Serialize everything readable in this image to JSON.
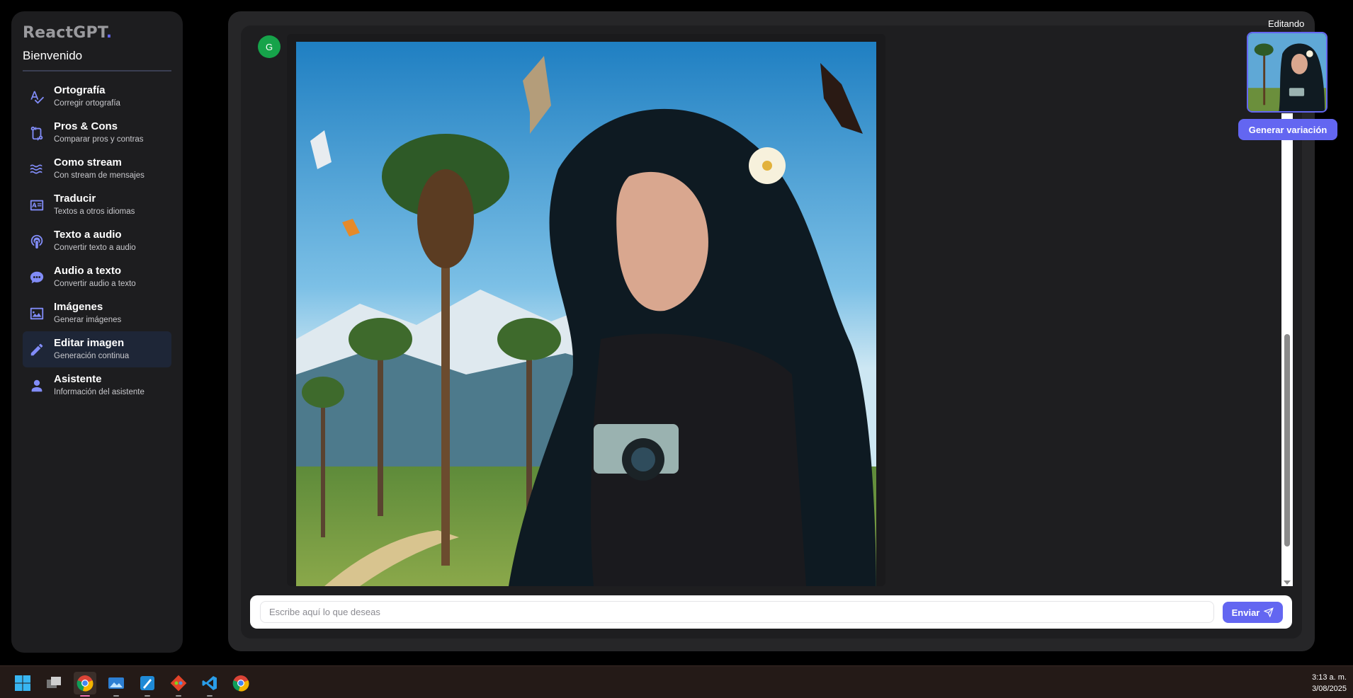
{
  "sidebar": {
    "brand": "ReactGPT",
    "brand_dot": ".",
    "welcome": "Bienvenido",
    "items": [
      {
        "title": "Ortografía",
        "subtitle": "Corregir ortografía",
        "icon": "spellcheck-icon"
      },
      {
        "title": "Pros & Cons",
        "subtitle": "Comparar pros y contras",
        "icon": "compare-arrows-icon"
      },
      {
        "title": "Como stream",
        "subtitle": "Con stream de mensajes",
        "icon": "waves-icon"
      },
      {
        "title": "Traducir",
        "subtitle": "Textos a otros idiomas",
        "icon": "translate-card-icon"
      },
      {
        "title": "Texto a audio",
        "subtitle": "Convertir texto a audio",
        "icon": "podcast-icon"
      },
      {
        "title": "Audio a texto",
        "subtitle": "Convertir audio a texto",
        "icon": "chat-bubble-icon"
      },
      {
        "title": "Imágenes",
        "subtitle": "Generar imágenes",
        "icon": "image-icon"
      },
      {
        "title": "Editar imagen",
        "subtitle": "Generación continua",
        "icon": "pencil-icon",
        "active": true
      },
      {
        "title": "Asistente",
        "subtitle": "Información del asistente",
        "icon": "user-icon"
      }
    ]
  },
  "chat": {
    "avatar_letter": "G",
    "image_alt": "anime-girl-camera-palm-trees-butterflies"
  },
  "editing": {
    "label": "Editando",
    "button": "Generar variación"
  },
  "input": {
    "placeholder": "Escribe aquí lo que deseas",
    "value": "",
    "send_label": "Enviar"
  },
  "taskbar": {
    "apps": [
      "windows-start-icon",
      "task-view-icon",
      "chrome-icon",
      "photos-icon",
      "paint-icon",
      "git-icon",
      "vscode-icon",
      "chrome-icon"
    ],
    "time": "3:13 a. m.",
    "date": "3/08/2025"
  },
  "colors": {
    "accent": "#6366f1",
    "avatar": "#16a34a",
    "panel": "#262628"
  }
}
